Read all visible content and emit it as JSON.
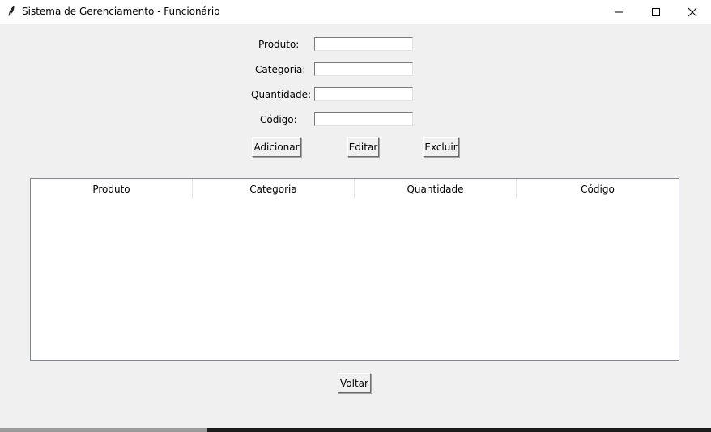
{
  "window": {
    "title": "Sistema de Gerenciamento - Funcionário",
    "icon": "feather-icon",
    "controls": [
      "minimize-icon",
      "maximize-icon",
      "close-icon"
    ]
  },
  "form": {
    "produto_label": "Produto:",
    "produto_value": "",
    "categoria_label": "Categoria:",
    "categoria_value": "",
    "quantidade_label": "Quantidade:",
    "quantidade_value": "",
    "codigo_label": "Código:",
    "codigo_value": ""
  },
  "actions": {
    "add_label": "Adicionar",
    "edit_label": "Editar",
    "delete_label": "Excluir"
  },
  "table": {
    "columns": [
      "Produto",
      "Categoria",
      "Quantidade",
      "Código"
    ],
    "rows": []
  },
  "footer": {
    "back_label": "Voltar"
  }
}
